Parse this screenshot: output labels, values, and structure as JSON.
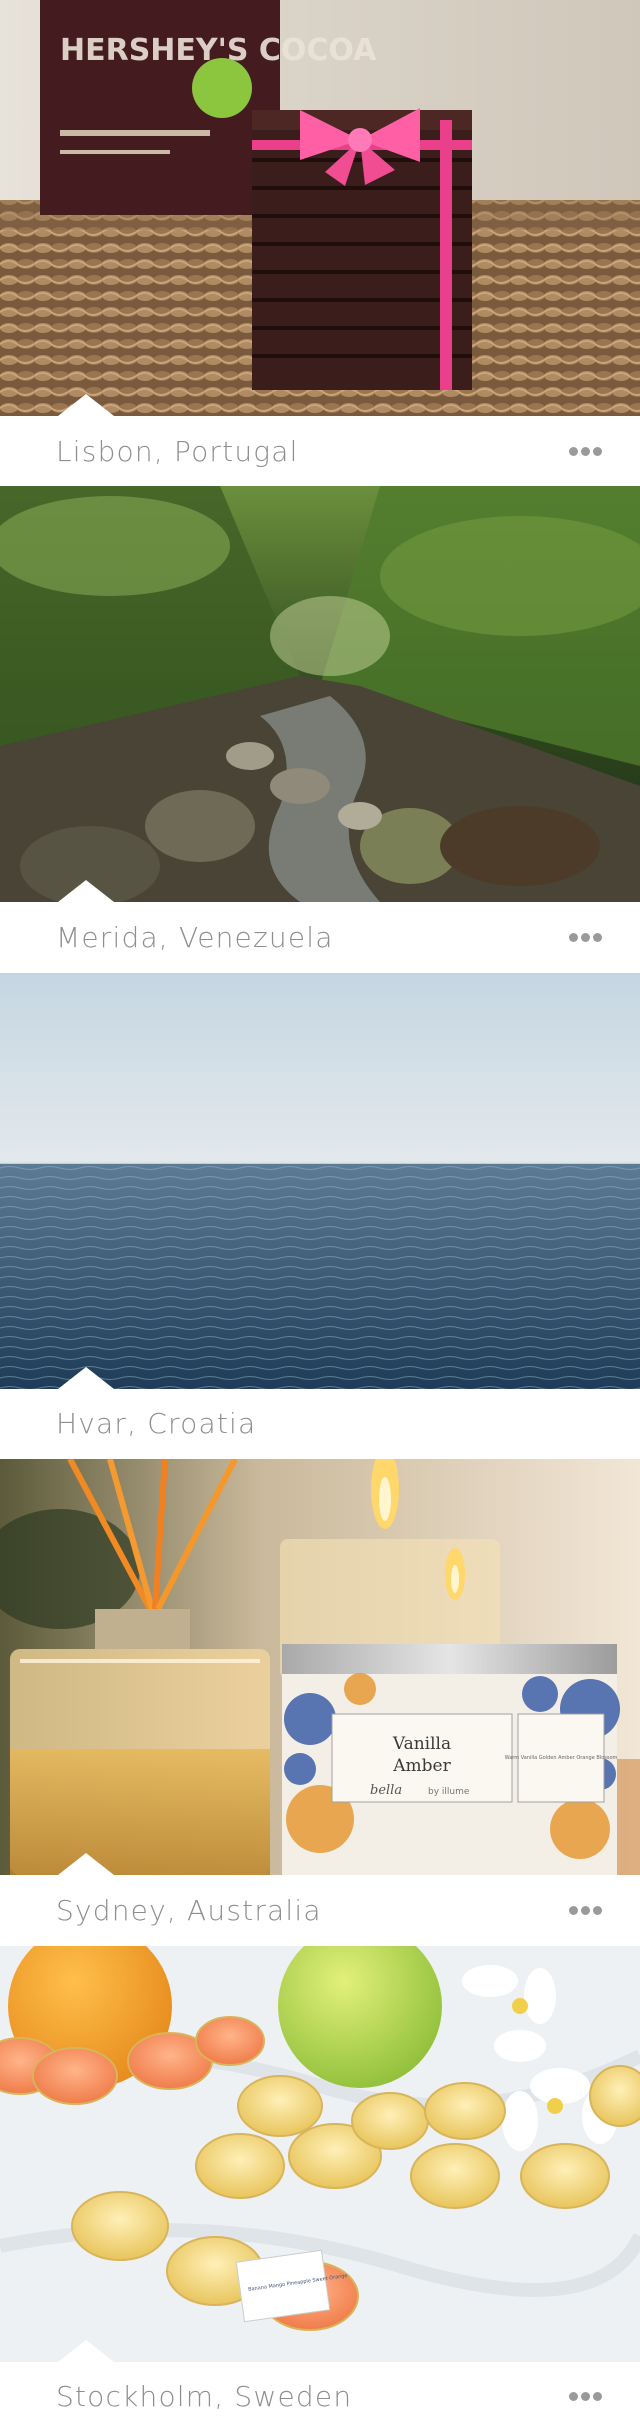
{
  "feed": {
    "items": [
      {
        "location": "Lisbon, Portugal",
        "photo_icon": "chocolate-bars-photo",
        "more_icon": "more-icon"
      },
      {
        "location": "Merida, Venezuela",
        "photo_icon": "jungle-stream-photo",
        "more_icon": "more-icon"
      },
      {
        "location": "Hvar, Croatia",
        "photo_icon": "sea-horizon-photo",
        "more_icon": "more-icon"
      },
      {
        "location": "Sydney, Australia",
        "photo_icon": "candles-diffuser-photo",
        "more_icon": "more-icon"
      },
      {
        "location": "Stockholm, Sweden",
        "photo_icon": "tealights-fruit-photo",
        "more_icon": "more-icon"
      }
    ]
  },
  "photo_labels": {
    "cocoa_box": "HERSHEY'S COCOA",
    "candle_line1": "Vanilla",
    "candle_line2": "Amber",
    "candle_brand": "bella",
    "candle_by": "by illume",
    "candle_side": "Warm Vanilla Golden Amber Orange Blossom",
    "tealight_tag": "Banana Mango Pineapple Sweet Orange"
  },
  "colors": {
    "caption_bg": "#ffffff",
    "caption_text": "#8e8e8e",
    "more_dots": "#9a9a9a"
  }
}
